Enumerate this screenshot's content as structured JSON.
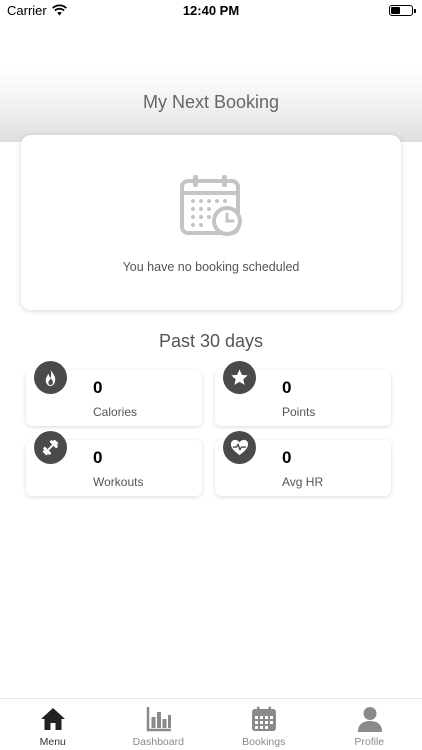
{
  "status_bar": {
    "carrier": "Carrier",
    "time": "12:40 PM",
    "battery_level": 0.45
  },
  "header": {
    "title": "My Next Booking"
  },
  "booking": {
    "empty_message": "You have no booking scheduled",
    "icon": "calendar-clock-icon"
  },
  "past_section": {
    "title": "Past 30 days"
  },
  "stats": [
    {
      "value": "0",
      "label": "Calories",
      "icon": "flame-icon"
    },
    {
      "value": "0",
      "label": "Points",
      "icon": "star-icon"
    },
    {
      "value": "0",
      "label": "Workouts",
      "icon": "dumbbell-icon"
    },
    {
      "value": "0",
      "label": "Avg HR",
      "icon": "heart-rate-icon"
    }
  ],
  "tabs": [
    {
      "label": "Menu",
      "icon": "home-icon",
      "active": true
    },
    {
      "label": "Dashboard",
      "icon": "bar-chart-icon",
      "active": false
    },
    {
      "label": "Bookings",
      "icon": "calendar-icon",
      "active": false
    },
    {
      "label": "Profile",
      "icon": "user-icon",
      "active": false
    }
  ],
  "colors": {
    "icon_dark": "#4a4a4a",
    "tab_inactive": "#8a8a8a",
    "tab_active": "#222222"
  }
}
